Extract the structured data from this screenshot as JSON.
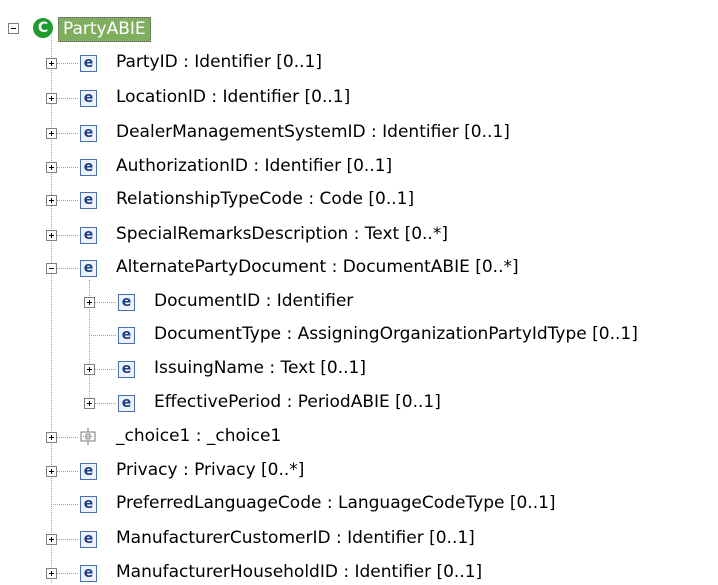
{
  "tree": {
    "root": {
      "label": "PartyABIE",
      "icon": "complex-type-c-icon"
    },
    "items": [
      {
        "label": "PartyID : Identifier [0..1]",
        "icon": "element-e-icon",
        "expander": "plus"
      },
      {
        "label": "LocationID : Identifier [0..1]",
        "icon": "element-e-icon",
        "expander": "plus"
      },
      {
        "label": "DealerManagementSystemID : Identifier [0..1]",
        "icon": "element-e-icon",
        "expander": "plus"
      },
      {
        "label": "AuthorizationID : Identifier [0..1]",
        "icon": "element-e-icon",
        "expander": "plus"
      },
      {
        "label": "RelationshipTypeCode : Code [0..1]",
        "icon": "element-e-icon",
        "expander": "plus"
      },
      {
        "label": "SpecialRemarksDescription : Text [0..*]",
        "icon": "element-e-icon",
        "expander": "plus"
      },
      {
        "label": "AlternatePartyDocument : DocumentABIE [0..*]",
        "icon": "element-e-icon",
        "expander": "minus",
        "children": [
          {
            "label": "DocumentID : Identifier",
            "icon": "element-e-icon",
            "expander": "plus"
          },
          {
            "label": "DocumentType : AssigningOrganizationPartyIdType [0..1]",
            "icon": "element-e-icon",
            "expander": "none"
          },
          {
            "label": "IssuingName : Text [0..1]",
            "icon": "element-e-icon",
            "expander": "plus"
          },
          {
            "label": "EffectivePeriod : PeriodABIE [0..1]",
            "icon": "element-e-icon",
            "expander": "plus"
          }
        ]
      },
      {
        "label": "_choice1 : _choice1",
        "icon": "choice-icon",
        "expander": "plus"
      },
      {
        "label": "Privacy : Privacy [0..*]",
        "icon": "element-e-icon",
        "expander": "plus"
      },
      {
        "label": "PreferredLanguageCode : LanguageCodeType [0..1]",
        "icon": "element-e-icon",
        "expander": "none"
      },
      {
        "label": "ManufacturerCustomerID : Identifier [0..1]",
        "icon": "element-e-icon",
        "expander": "plus"
      },
      {
        "label": "ManufacturerHouseholdID : Identifier [0..1]",
        "icon": "element-e-icon",
        "expander": "plus"
      }
    ]
  },
  "colors": {
    "root_highlight": "#7fae5e",
    "class_icon": "#1f9c2e",
    "element_icon_border": "#4a6fb0",
    "element_icon_text": "#1d3f86"
  }
}
